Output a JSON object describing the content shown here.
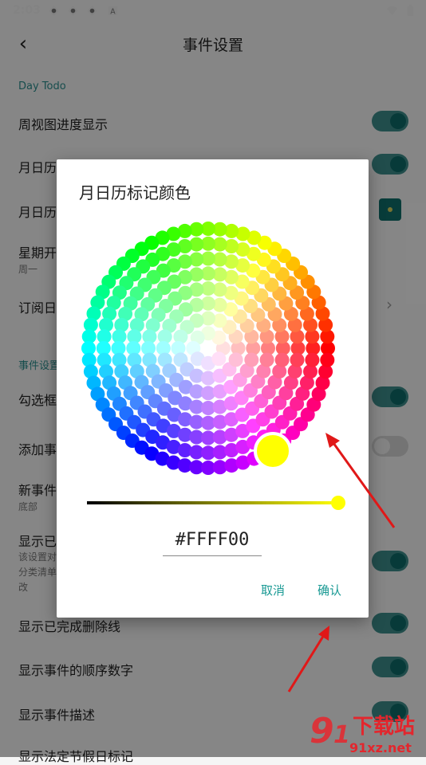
{
  "status_bar": {
    "time": "2:03",
    "icons": [
      "app-notification-icon",
      "app-notification-icon",
      "app-notification-icon",
      "text-notification-icon",
      "wifi-icon",
      "battery-icon"
    ]
  },
  "app_bar": {
    "back_icon": "back-arrow-icon",
    "title": "事件设置"
  },
  "sections": [
    {
      "header": "Day Todo"
    },
    {
      "header": "事件设置"
    }
  ],
  "settings": [
    {
      "label": "周视图进度显示",
      "control": "toggle",
      "on": true
    },
    {
      "label": "月日历",
      "control": "toggle",
      "on": true
    },
    {
      "label": "月日历",
      "control": "swatch"
    },
    {
      "label": "星期开",
      "sub": "周一"
    },
    {
      "label": "订阅日",
      "control": "chevron"
    },
    {
      "label": "勾选框",
      "control": "toggle",
      "on": true
    },
    {
      "label": "添加事",
      "control": "toggle",
      "on": false
    },
    {
      "label": "新事件",
      "sub": "底部"
    },
    {
      "label": "显示已",
      "sub_lines": [
        "该设置对",
        "分类清单",
        "改"
      ],
      "control": "toggle",
      "on": true
    },
    {
      "label": "显示已完成删除线",
      "control": "toggle",
      "on": true
    },
    {
      "label": "显示事件的顺序数字",
      "control": "toggle",
      "on": true
    },
    {
      "label": "显示事件描述",
      "control": "toggle",
      "on": true
    },
    {
      "label": "显示法定节假日标记"
    }
  ],
  "dialog": {
    "title": "月日历标记颜色",
    "selected_color": "#FFFF00",
    "hex_value": "#FFFF00",
    "lightness": 1.0,
    "cancel_label": "取消",
    "confirm_label": "确认"
  },
  "watermark": {
    "text": "91xz.net",
    "brand": "下载站"
  },
  "colors": {
    "accent": "#1a9a94",
    "toggle_on": "#3c8d8b"
  }
}
